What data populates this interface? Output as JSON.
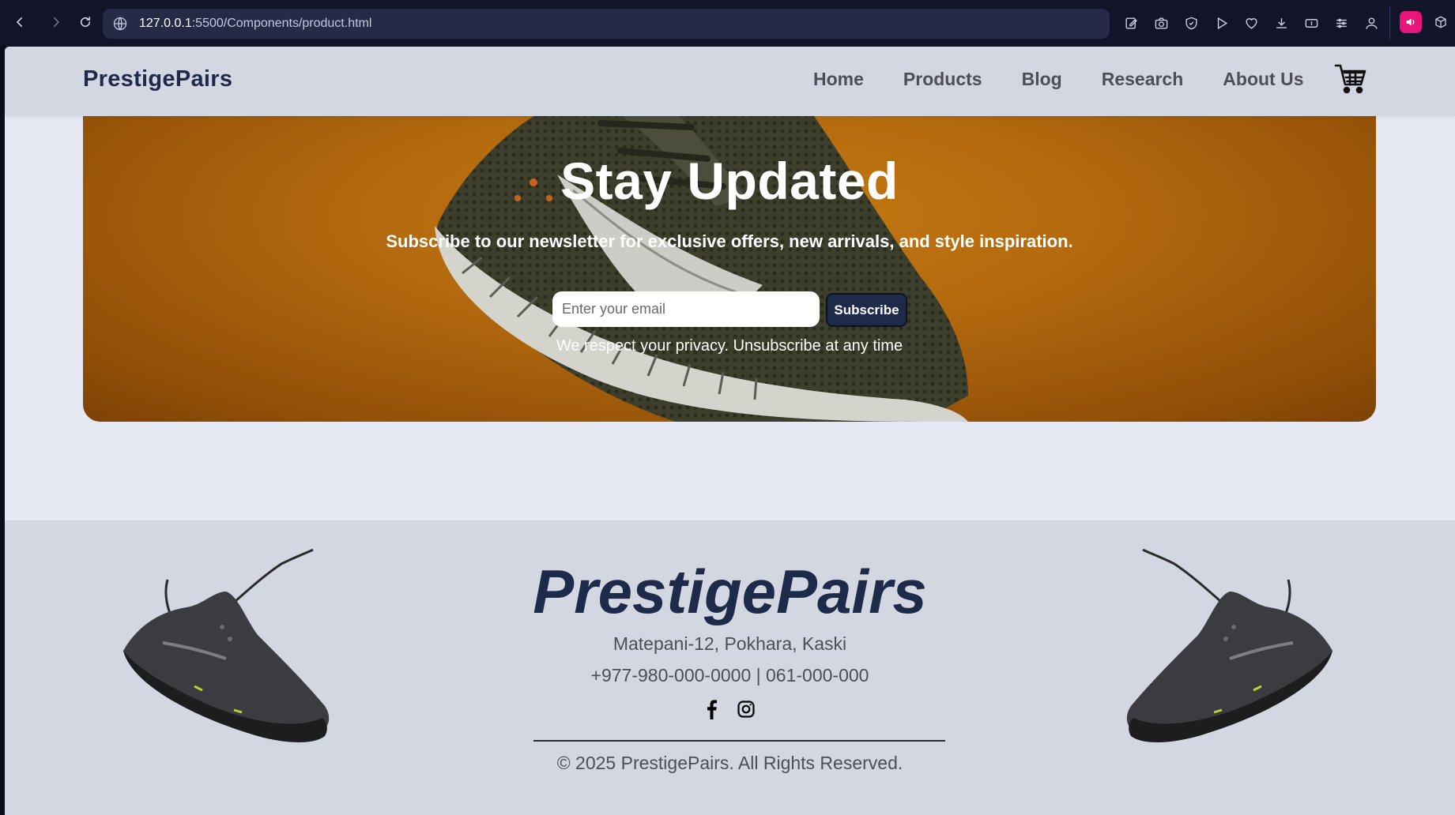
{
  "browser": {
    "url_host": "127.0.0.1",
    "url_path": ":5500/Components/product.html",
    "icons": [
      "back-icon",
      "forward-icon",
      "reload-icon",
      "globe-icon",
      "edit-icon",
      "camera-icon",
      "shield-icon",
      "play-icon",
      "heart-icon",
      "download-icon",
      "battery-icon",
      "menu-icon",
      "profile-icon",
      "extension-icon",
      "box-icon"
    ]
  },
  "navbar": {
    "brand": "PrestigePairs",
    "links": [
      "Home",
      "Products",
      "Blog",
      "Research",
      "About Us"
    ],
    "cart_icon": "cart-icon"
  },
  "newsletter": {
    "title": "Stay Updated",
    "subtitle": "Subscribe to our newsletter for exclusive offers, new arrivals, and style inspiration.",
    "email_placeholder": "Enter your email",
    "email_value": "",
    "button_label": "Subscribe",
    "privacy_note": "We respect your privacy. Unsubscribe at any time"
  },
  "footer": {
    "brand": "PrestigePairs",
    "address": "Matepani-12, Pokhara, Kaski",
    "phone": "+977-980-000-0000 | 061-000-000",
    "social_icons": [
      "facebook-icon",
      "instagram-icon"
    ],
    "copyright": "© 2025 PrestigePairs. All Rights Reserved."
  },
  "colors": {
    "brand_navy": "#1e2a4a",
    "navbar_bg": "#d3d7e1",
    "page_bg": "#e6e9f4",
    "hero_orange": "#b3690e",
    "browser_bg": "#121529",
    "extension_pink": "#e8157a"
  }
}
